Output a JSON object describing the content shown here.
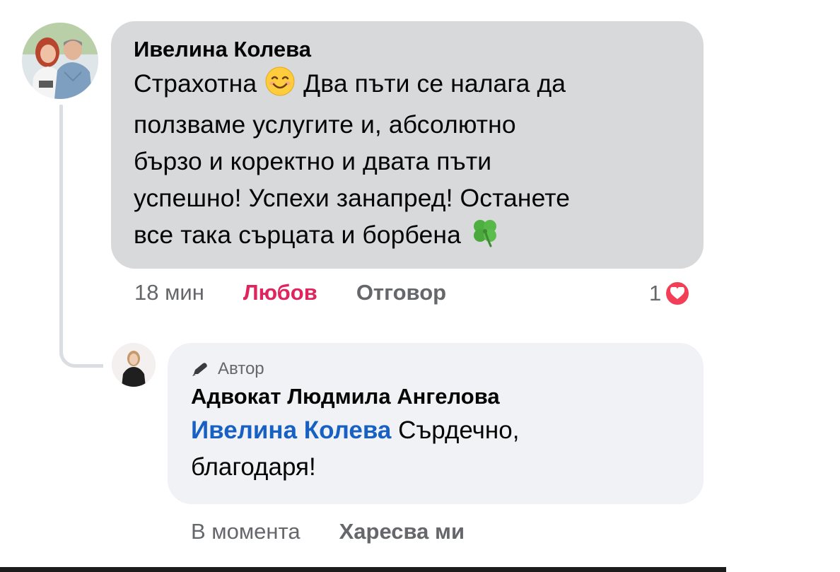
{
  "comment": {
    "author": "Ивелина Колева",
    "text_lines": [
      "Страхотна",
      "Два пъти се налага да",
      "ползваме услугите и, абсолютно",
      "бързо и коректно и двата пъти",
      "успешно! Успехи занапред! Останете",
      "все така сърцата и борбена"
    ],
    "emoji_smile": "smiling-face-emoji",
    "emoji_clover": "four-leaf-clover-emoji",
    "time": "18 мин",
    "reaction_label": "Любов",
    "reply_label": "Отговор",
    "reaction_count": "1",
    "reaction_icon": "heart-icon"
  },
  "reply": {
    "badge": "Автор",
    "author": "Адвокат Людмила Ангелова",
    "mention": "Ивелина Колева",
    "text_line1": "Сърдечно,",
    "text_line2": "благодаря!",
    "time": "В момента",
    "like_label": "Харесва ми"
  },
  "colors": {
    "bubble_primary": "#d8d9db",
    "bubble_reply": "#f0f2f5",
    "love": "#e0245e",
    "mention": "#1861c4",
    "muted": "#65676b"
  }
}
